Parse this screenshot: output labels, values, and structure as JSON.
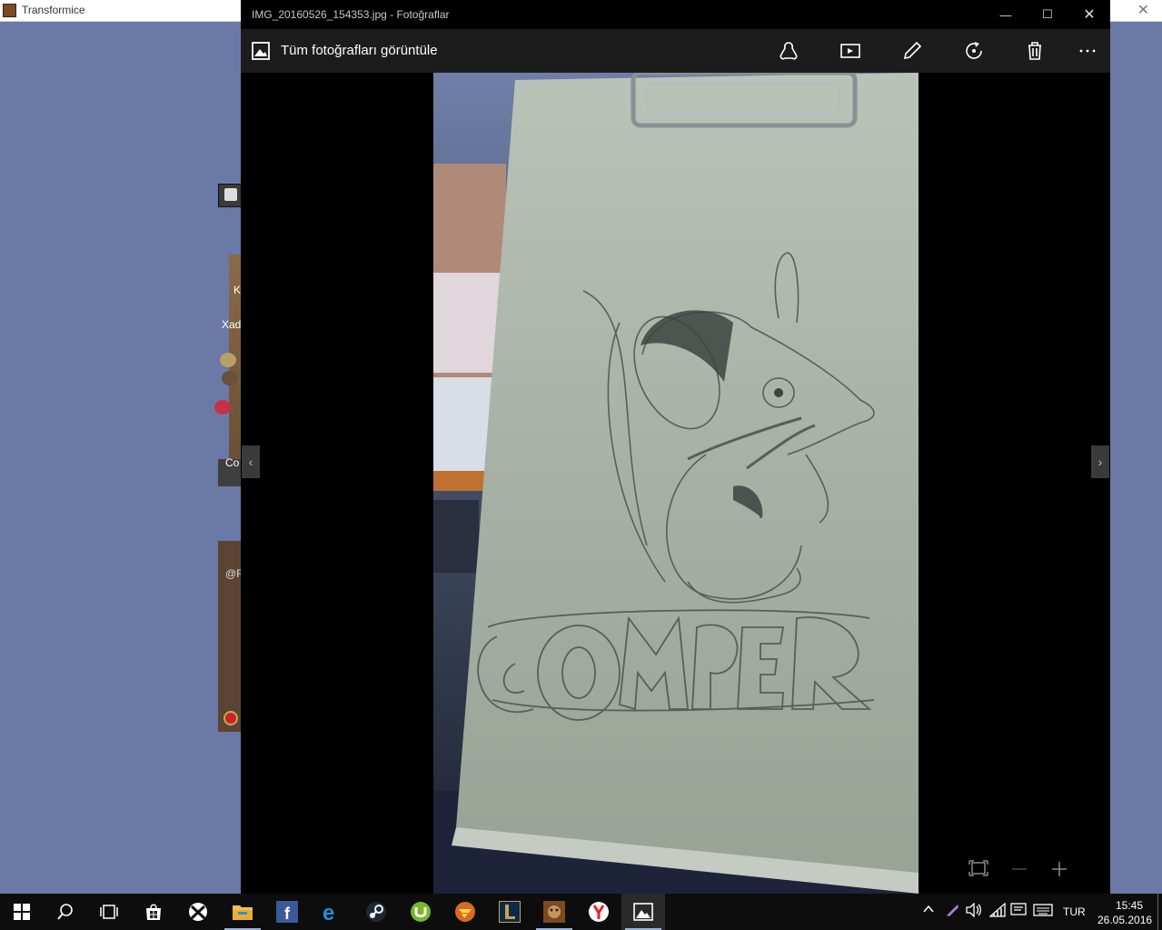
{
  "background_window": {
    "title": "Transformice",
    "game_labels": [
      "K",
      "Xad",
      "Co",
      "@R"
    ]
  },
  "photos_window": {
    "title": "IMG_20160526_154353.jpg - Fotoğraflar",
    "view_all_label": "Tüm fotoğrafları görüntüle",
    "toolbar_icons": [
      "share-icon",
      "slideshow-icon",
      "edit-icon",
      "rotate-icon",
      "delete-icon",
      "more-icon"
    ],
    "image": {
      "sketch_text": "COMPER"
    },
    "zoom_icons": [
      "fit-icon",
      "zoom-out-icon",
      "zoom-in-icon"
    ]
  },
  "taskbar": {
    "apps": [
      "start",
      "search",
      "task-view",
      "store",
      "xbox",
      "file-explorer",
      "facebook",
      "edge",
      "steam",
      "utorrent",
      "game-launcher",
      "league-of-legends",
      "transformice",
      "yandex",
      "photos"
    ],
    "language": "TUR",
    "time": "15:45",
    "date": "26.05.2016"
  },
  "colors": {
    "desktop": "#6b79a6",
    "taskbar": "#0d0d0d",
    "accent": "#9ab2d6"
  }
}
